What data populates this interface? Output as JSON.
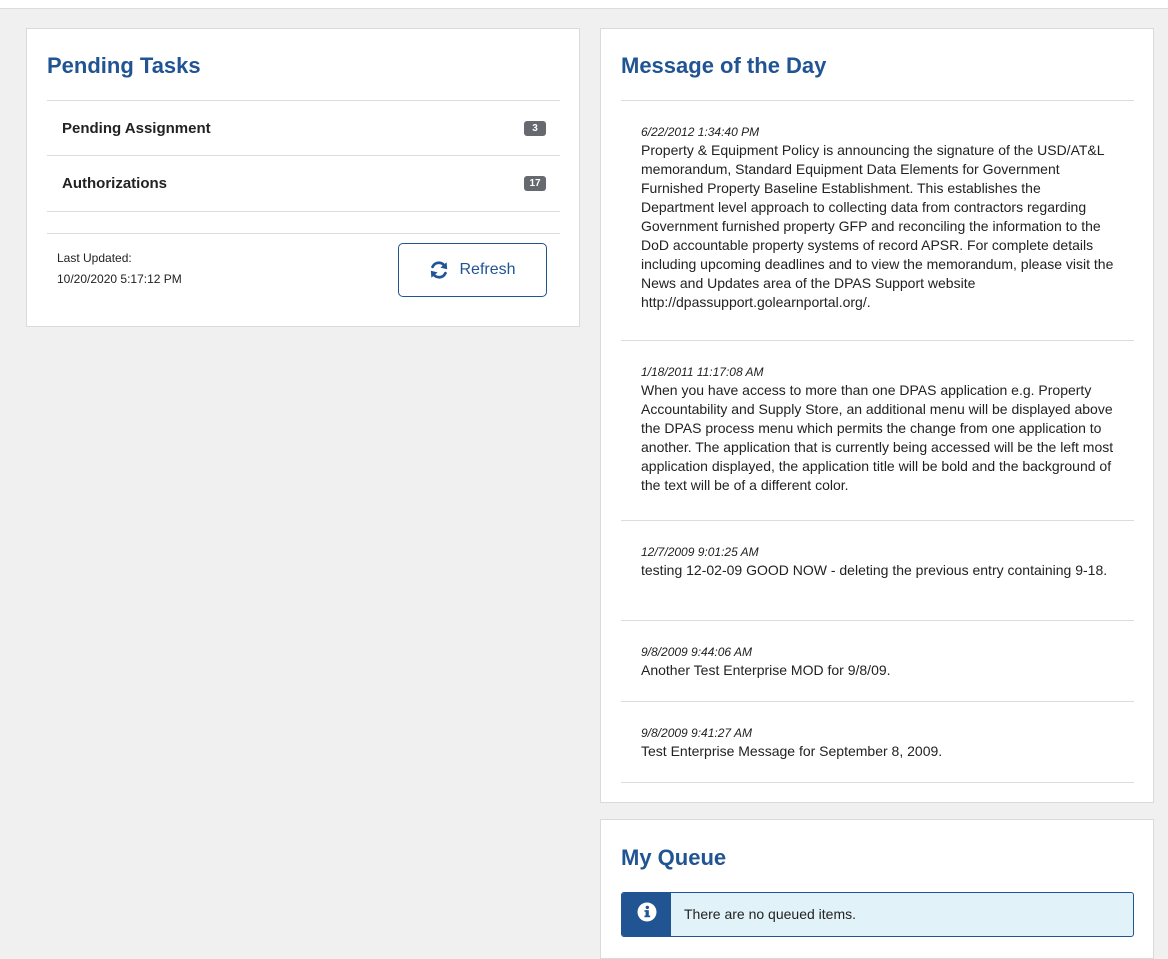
{
  "pending_tasks": {
    "title": "Pending Tasks",
    "rows": [
      {
        "label": "Pending Assignment",
        "count": "3"
      },
      {
        "label": "Authorizations",
        "count": "17"
      }
    ],
    "last_updated_label": "Last Updated:",
    "last_updated_value": "10/20/2020 5:17:12 PM",
    "refresh_label": "Refresh",
    "refresh_icon": "refresh-icon"
  },
  "motd": {
    "title": "Message of the Day",
    "messages": [
      {
        "date": "6/22/2012 1:34:40 PM",
        "text": "Property & Equipment Policy is announcing the signature of the USD/AT&L memorandum, Standard Equipment Data Elements for Government Furnished Property Baseline Establishment. This establishes the Department level approach to collecting data from contractors regarding Government furnished property GFP and reconciling the information to the DoD accountable property systems of record APSR. For complete details including upcoming deadlines and to view the memorandum, please visit the News and Updates area of the DPAS Support website http://dpassupport.golearnportal.org/."
      },
      {
        "date": "1/18/2011 11:17:08 AM",
        "text": "When you have access to more than one DPAS application e.g. Property Accountability and Supply Store, an additional menu will be displayed above the DPAS process menu which permits the change from one application to another. The application that is currently being accessed will be the left most application displayed, the application title will be bold and the background of the text will be of a different color."
      },
      {
        "date": "12/7/2009 9:01:25 AM",
        "text": "testing 12-02-09 GOOD NOW - deleting the previous entry containing 9-18."
      },
      {
        "date": "9/8/2009 9:44:06 AM",
        "text": "Another Test Enterprise MOD for 9/8/09."
      },
      {
        "date": "9/8/2009 9:41:27 AM",
        "text": "Test Enterprise Message for September 8, 2009."
      }
    ]
  },
  "queue": {
    "title": "My Queue",
    "alert_text": "There are no queued items.",
    "alert_icon": "info-icon"
  },
  "colors": {
    "accent": "#205493",
    "alert_bg": "#e1f3f8",
    "badge": "#666a70",
    "page_bg": "#f0f0f0"
  }
}
